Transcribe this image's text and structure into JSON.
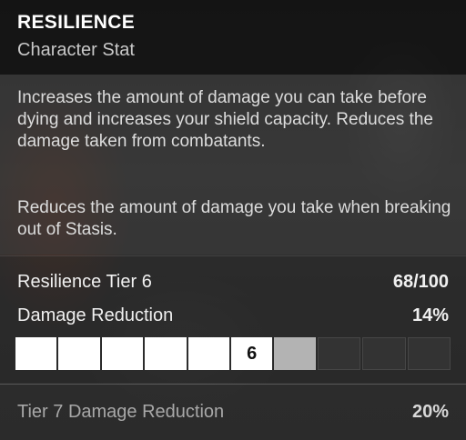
{
  "header": {
    "title": "RESILIENCE",
    "subtitle": "Character Stat"
  },
  "description": {
    "paragraph_1": "Increases the amount of damage you can take before dying and increases your shield capacity. Reduces the damage taken from combatants.",
    "paragraph_2": "Reduces the amount of damage you take when breaking out of Stasis."
  },
  "stats": {
    "tier_label": "Resilience Tier 6",
    "tier_value": "68/100",
    "damage_reduction_label": "Damage Reduction",
    "damage_reduction_value": "14%",
    "tier_bar": {
      "total_segments": 10,
      "filled_segments": 6,
      "partial_segment_fill": 0.8,
      "current_tier_label": "6",
      "stat_value": 68,
      "stat_max": 100
    }
  },
  "footer": {
    "next_tier_label": "Tier 7 Damage Reduction",
    "next_tier_value": "20%"
  },
  "colors": {
    "filled": "#ffffff",
    "partial": "#b3b3b3",
    "empty": "#373737"
  }
}
